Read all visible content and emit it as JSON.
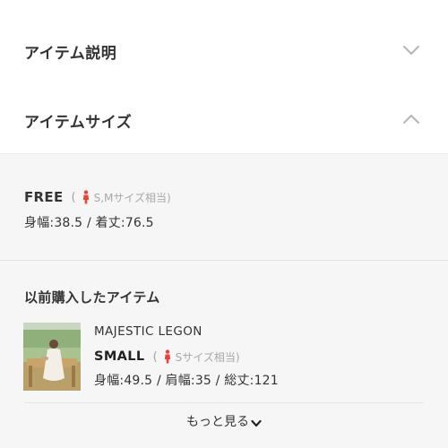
{
  "accordion": {
    "description": {
      "title": "アイテム説明",
      "state": "collapsed",
      "icon": "chevron-down-icon"
    },
    "size": {
      "title": "アイテムサイズ",
      "state": "expanded",
      "icon": "chevron-up-icon"
    }
  },
  "size_info": {
    "name": "FREE",
    "open_paren": "(",
    "hint": "S,Mサイズ相当)",
    "person_icon": "person-icon",
    "person_color": "#e0463c",
    "measurements": "身幅:38.5 / 着丈:76.5"
  },
  "previous_items": {
    "title": "以前購入したアイテム",
    "items": [
      {
        "brand": "MAJESTIC LEGON",
        "size": "SMALL",
        "open_paren": "(",
        "hint": "Sサイズ相当)",
        "measurements": "身幅:49.5 / 肩幅:35 / 総丈:121"
      }
    ],
    "more_label": "もっと見る"
  },
  "colors": {
    "panel_bg": "#f6f6f6",
    "chevron": "#b5b5b5"
  }
}
